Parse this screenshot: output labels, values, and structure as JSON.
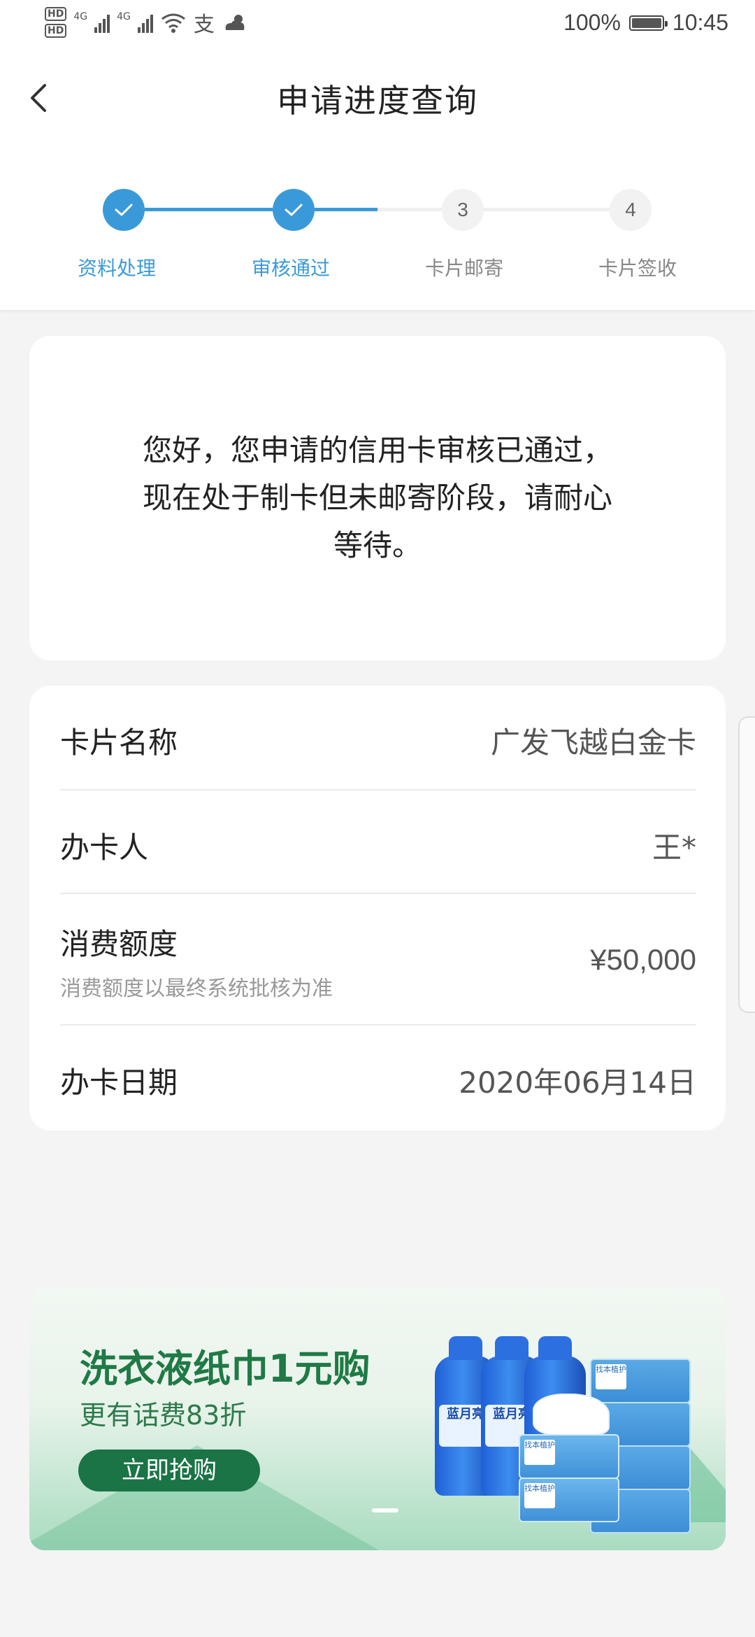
{
  "status_bar": {
    "hd1": "HD",
    "hd2": "HD",
    "net1": "4G",
    "net2": "4G",
    "alipay_glyph": "支",
    "battery_pct": "100%",
    "time": "10:45",
    "battery_level": 1.0
  },
  "header": {
    "title": "申请进度查询",
    "back_icon": "back-chevron-icon"
  },
  "steps": [
    {
      "label": "资料处理",
      "state": "done",
      "number": ""
    },
    {
      "label": "审核通过",
      "state": "done",
      "number": ""
    },
    {
      "label": "卡片邮寄",
      "state": "pending",
      "number": "3"
    },
    {
      "label": "卡片签收",
      "state": "pending",
      "number": "4"
    }
  ],
  "message": "您好，您申请的信用卡审核已通过，现在处于制卡但未邮寄阶段，请耐心等待。",
  "info": {
    "card_name_label": "卡片名称",
    "card_name_value": "广发飞越白金卡",
    "holder_label": "办卡人",
    "holder_value": "王*",
    "limit_label": "消费额度",
    "limit_note": "消费额度以最终系统批核为准",
    "limit_value": "¥50,000",
    "date_label": "办卡日期",
    "date_value": "2020年06月14日"
  },
  "banner": {
    "title": "洗衣液纸巾1元购",
    "subtitle": "更有话费83折",
    "button": "立即抢购",
    "bottle_text": "蓝月亮",
    "tissue_tag": "找本植护"
  },
  "colors": {
    "accent": "#3a9ad9",
    "banner_green": "#1f7a45",
    "button_green": "#1a7446"
  }
}
